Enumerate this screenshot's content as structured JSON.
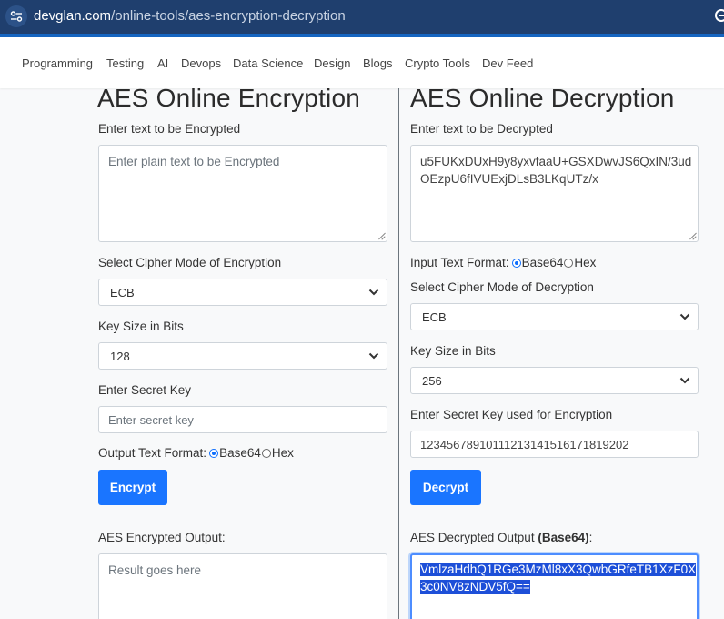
{
  "browser": {
    "url_host": "devglan.com",
    "url_path": "/online-tools/aes-encryption-decryption"
  },
  "nav": {
    "items": [
      "Programming",
      "Testing",
      "AI",
      "Devops",
      "Data Science",
      "Design",
      "Blogs",
      "Crypto Tools",
      "Dev Feed"
    ]
  },
  "encryption": {
    "title": "AES Online Encryption",
    "input_label": "Enter text to be Encrypted",
    "input_placeholder": "Enter plain text to be Encrypted",
    "mode_label": "Select Cipher Mode of Encryption",
    "mode_value": "ECB",
    "keysize_label": "Key Size in Bits",
    "keysize_value": "128",
    "secret_label": "Enter Secret Key",
    "secret_placeholder": "Enter secret key",
    "output_format_label": "Output Text Format:",
    "format_option_base64": "Base64",
    "format_option_hex": "Hex",
    "format_selected": "Base64",
    "button_label": "Encrypt",
    "output_label": "AES Encrypted Output:",
    "output_placeholder": "Result goes here"
  },
  "decryption": {
    "title": "AES Online Decryption",
    "input_label": "Enter text to be Decrypted",
    "input_value_line1": "u5FUKxDUxH9y8yxvfaaU+GSXDwvJS6QxIN/3ud",
    "input_value_line2": "OEzpU6fIVUExjDLsB3LKqUTz/x",
    "input_format_label": "Input Text Format:",
    "format_option_base64": "Base64",
    "format_option_hex": "Hex",
    "format_selected": "Base64",
    "mode_label": "Select Cipher Mode of Decryption",
    "mode_value": "ECB",
    "keysize_label": "Key Size in Bits",
    "keysize_value": "256",
    "secret_label": "Enter Secret Key used for Encryption",
    "secret_value": "12345678910111213141516171819202",
    "button_label": "Decrypt",
    "output_label": "AES Decrypted Output",
    "output_format_tag": "(Base64)",
    "output_label_suffix": ":",
    "output_line1": "VmlzaHdhQ1RGe3MzMl8xX3QwbGRfeTB1XzF0X",
    "output_line2": "3c0NV8zNDV5fQ=="
  },
  "colors": {
    "addressbar": "#1f3f6e",
    "button": "#1a75ff",
    "selection": "#1d4fd8"
  }
}
